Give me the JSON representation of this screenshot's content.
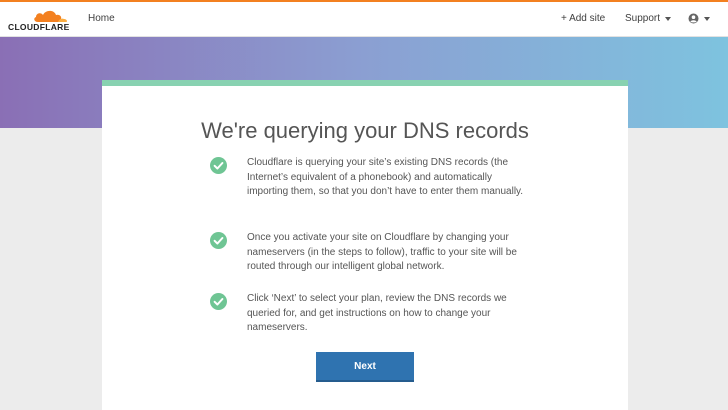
{
  "brand": {
    "name": "CLOUDFLARE",
    "accent": "#f38020"
  },
  "nav": {
    "home": "Home",
    "add_site": "+ Add site",
    "support": "Support"
  },
  "main": {
    "title": "We're querying your DNS records",
    "items": [
      {
        "text": "Cloudflare is querying your site’s existing DNS records (the Internet’s equivalent of a phonebook) and automatically importing them, so that you don’t have to enter them manually."
      },
      {
        "text": "Once you activate your site on Cloudflare by changing your nameservers (in the steps to follow), traffic to your site will be routed through our intelligent global network."
      },
      {
        "text": "Click ‘Next’ to select your plan, review the DNS records we queried for, and get instructions on how to change your nameservers."
      }
    ],
    "next_label": "Next"
  },
  "icons": {
    "check": "check-circle-icon",
    "user": "user-icon",
    "logo": "cloud-icon"
  },
  "colors": {
    "check": "#6fc594",
    "button": "#2f73b0",
    "card_top": "#88d2b1"
  }
}
